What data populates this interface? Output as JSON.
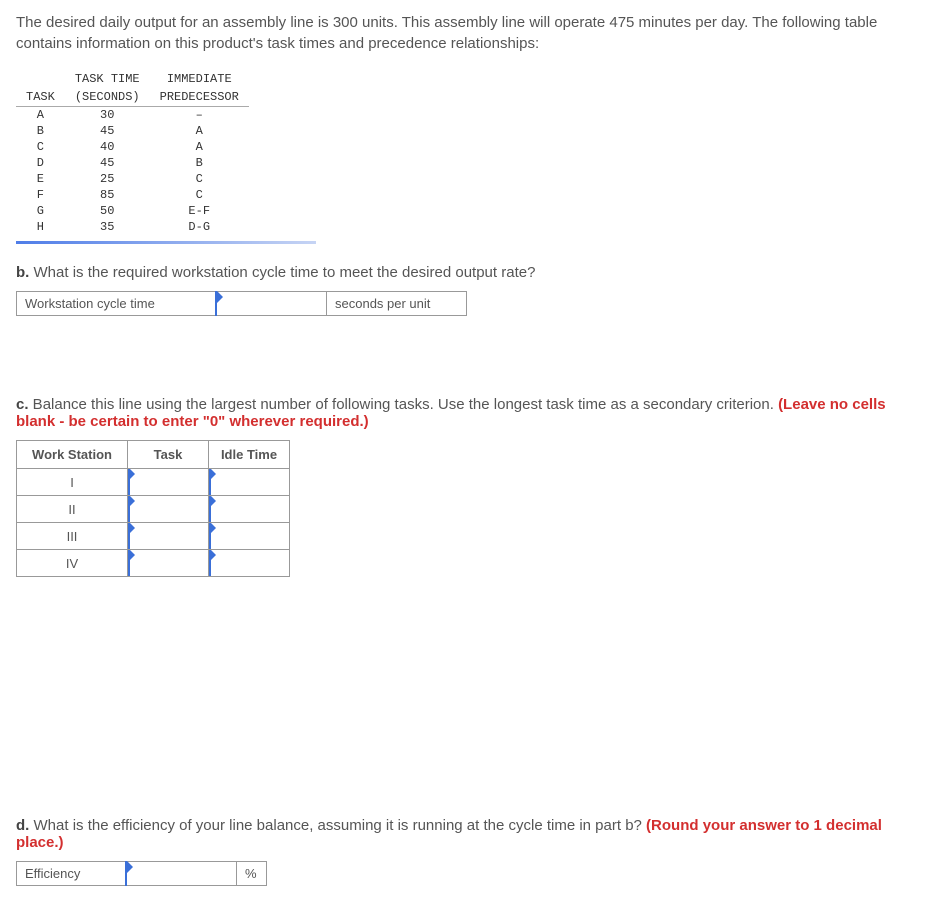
{
  "intro": "The desired daily output for an assembly line is 300 units. This assembly line will operate 475 minutes per day. The following table contains information on this product's task times and precedence relationships:",
  "task_table": {
    "headers": {
      "task_top": "",
      "task": "TASK",
      "time_top": "TASK TIME",
      "time": "(SECONDS)",
      "pred_top": "IMMEDIATE",
      "pred": "PREDECESSOR"
    },
    "rows": [
      {
        "task": "A",
        "time": "30",
        "pred": "–"
      },
      {
        "task": "B",
        "time": "45",
        "pred": "A"
      },
      {
        "task": "C",
        "time": "40",
        "pred": "A"
      },
      {
        "task": "D",
        "time": "45",
        "pred": "B"
      },
      {
        "task": "E",
        "time": "25",
        "pred": "C"
      },
      {
        "task": "F",
        "time": "85",
        "pred": "C"
      },
      {
        "task": "G",
        "time": "50",
        "pred": "E-F"
      },
      {
        "task": "H",
        "time": "35",
        "pred": "D-G"
      }
    ]
  },
  "part_b": {
    "prefix": "b.",
    "text": " What is the required workstation cycle time to meet the desired output rate?",
    "label": "Workstation cycle time",
    "unit": "seconds per unit"
  },
  "part_c": {
    "prefix": "c.",
    "text": " Balance this line using the largest number of following tasks. Use the longest task time as a secondary criterion. ",
    "red": "(Leave no cells blank - be certain to enter \"0\" wherever required.)",
    "headers": {
      "ws": "Work Station",
      "task": "Task",
      "idle": "Idle Time"
    },
    "rows": [
      "I",
      "II",
      "III",
      "IV"
    ]
  },
  "part_d": {
    "prefix": "d.",
    "text": " What is the efficiency of your line balance, assuming it is running at the cycle time in part b? ",
    "red": "(Round your answer to 1 decimal place.)",
    "label": "Efficiency",
    "unit": "%"
  }
}
